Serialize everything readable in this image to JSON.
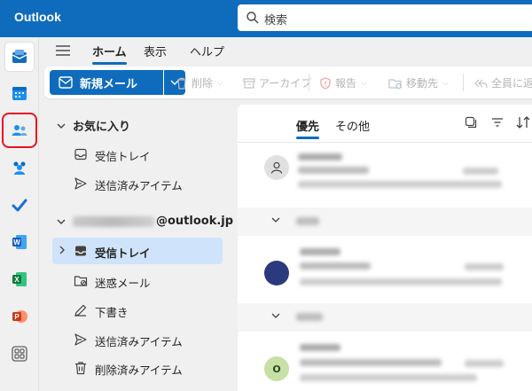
{
  "app": {
    "title": "Outlook"
  },
  "search": {
    "placeholder": "検索"
  },
  "ribbon_tabs": [
    "ホーム",
    "表示",
    "ヘルプ"
  ],
  "commands": {
    "new_mail": "新規メール",
    "delete": "削除",
    "archive": "アーカイブ",
    "report": "報告",
    "move": "移動先",
    "reply_all": "全員に返"
  },
  "folders": {
    "favorites": {
      "label": "お気に入り",
      "items": [
        "受信トレイ",
        "送信済みアイテム"
      ]
    },
    "account": {
      "label_suffix": "@outlook.jp",
      "items": [
        "受信トレイ",
        "迷惑メール",
        "下書き",
        "送信済みアイテム",
        "削除済みアイテム"
      ]
    }
  },
  "message_tabs": {
    "focused": "優先",
    "other": "その他"
  },
  "messages": [
    {
      "avatar_letter": "",
      "avatar_color": "#e0e0e0"
    },
    {
      "avatar_letter": "",
      "avatar_color": "#2b3a7e"
    },
    {
      "avatar_letter": "O",
      "avatar_color": "#c6e0a5"
    }
  ],
  "colors": {
    "brand": "#0f6cbd",
    "selected": "#cfe4fa",
    "highlight": "#e81123"
  }
}
